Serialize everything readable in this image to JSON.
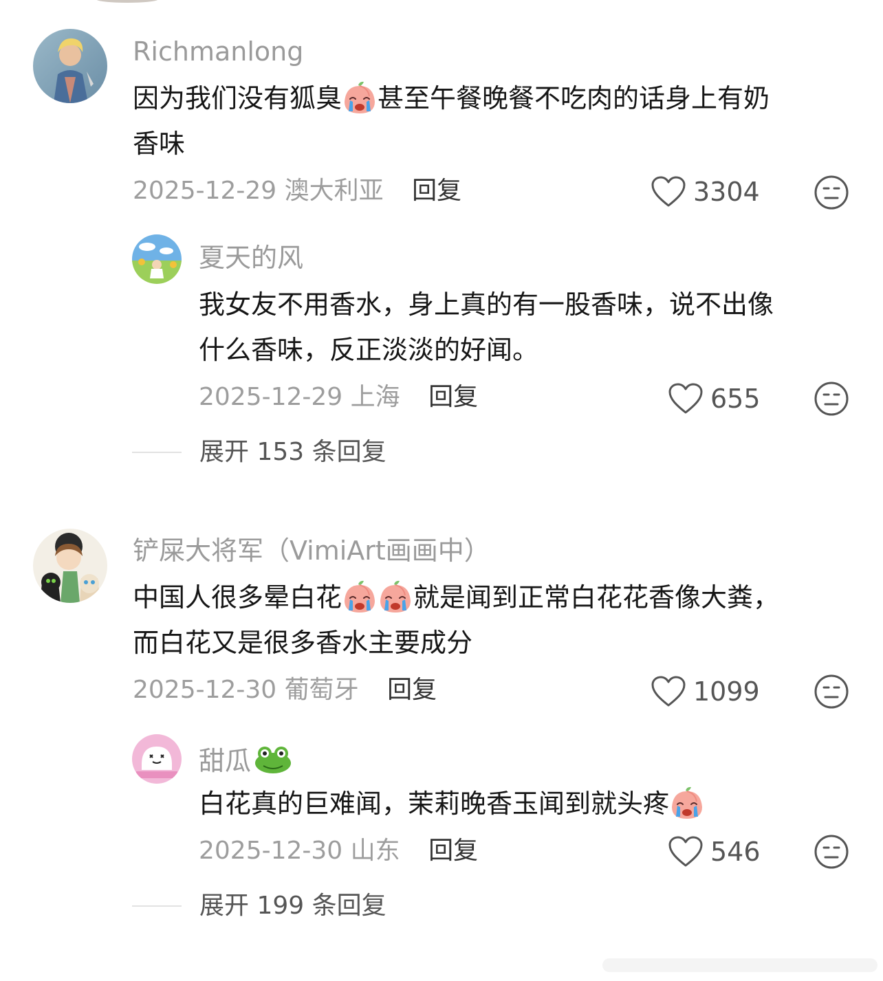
{
  "comments": [
    {
      "user": "Richmanlong",
      "text_a": "因为我们没有狐臭",
      "text_b": "甚至午餐晚餐不吃肉的话身上有奶",
      "text_c": "香味",
      "date": "2025-12-29",
      "location": "澳大利亚",
      "reply_label": "回复",
      "likes": "3304",
      "replies": [
        {
          "user": "夏天的风",
          "text_a": "我女友不用香水，身上真的有一股香味，说不出像",
          "text_b": "什么香味，反正淡淡的好闻。",
          "date": "2025-12-29",
          "location": "上海",
          "reply_label": "回复",
          "likes": "655"
        }
      ],
      "expand_label": "展开 153 条回复"
    },
    {
      "user": "铲屎大将军（VimiArt画画中）",
      "text_a": "中国人很多晕白花",
      "text_b": "就是闻到正常白花花香像大粪，",
      "text_c": "而白花又是很多香水主要成分",
      "date": "2025-12-30",
      "location": "葡萄牙",
      "reply_label": "回复",
      "likes": "1099",
      "replies": [
        {
          "user": "甜瓜",
          "name_emoji": "frog-face",
          "text_a": "白花真的巨难闻，茉莉晚香玉闻到就头疼",
          "date": "2025-12-30",
          "location": "山东",
          "reply_label": "回复",
          "likes": "546"
        }
      ],
      "expand_label": "展开 199 条回复"
    }
  ],
  "icons": {
    "emoji": "crying-peach-face",
    "like": "heart-outline",
    "dislike": "unamused-face-outline"
  },
  "colors": {
    "username": "#9a9a9a",
    "meta": "#9d9d9d",
    "body": "#161616",
    "icon": "#555555"
  }
}
